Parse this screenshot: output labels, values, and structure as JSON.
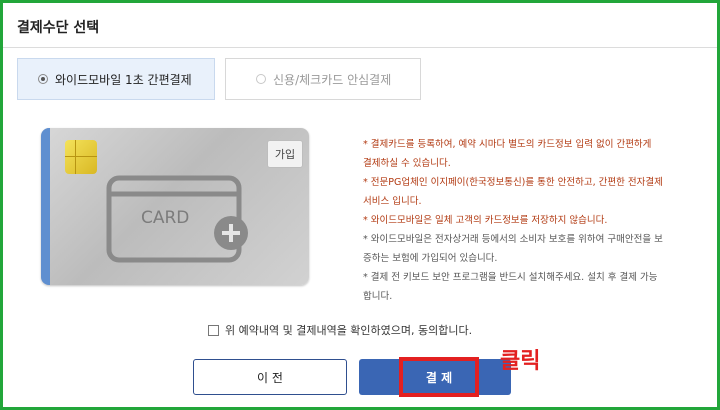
{
  "header": {
    "title": "결제수단 선택"
  },
  "tabs": [
    {
      "label": "와이드모바일 1초 간편결제",
      "selected": true
    },
    {
      "label": "신용/체크카드 안심결제",
      "selected": false
    }
  ],
  "card": {
    "text": "CARD",
    "join_label": "가입"
  },
  "notes": [
    {
      "text": "* 결제카드를 등록하여, 예약 시마다 별도의 카드정보 입력 없이 간편하게 결제하실 수 있습니다.",
      "color": "#b23a12"
    },
    {
      "text": "* 전문PG업체인 이지페이(한국정보통신)를 통한 안전하고, 간편한 전자결제 서비스 입니다.",
      "color": "#b23a12"
    },
    {
      "text": "* 와이드모바일은 일체 고객의 카드정보를 저장하지 않습니다.",
      "color": "#b23a12"
    },
    {
      "text": "* 와이드모바일은 전자상거래 등에서의 소비자 보호를 위하여 구매안전을 보증하는 보험에 가입되어 있습니다.",
      "color": "#555555"
    },
    {
      "text": "* 결제 전 키보드 보안 프로그램을 반드시 설치해주세요. 설치 후 결제 가능합니다.",
      "color": "#555555"
    }
  ],
  "agreement": {
    "label": "위 예약내역 및 결제내역을 확인하였으며, 동의합니다.",
    "checked": false
  },
  "buttons": {
    "prev": "이 전",
    "pay": "결 제"
  },
  "annotation": {
    "click": "클릭",
    "highlight_color": "#e32020"
  },
  "colors": {
    "accent": "#3a66b4",
    "frame": "#22a63a"
  }
}
